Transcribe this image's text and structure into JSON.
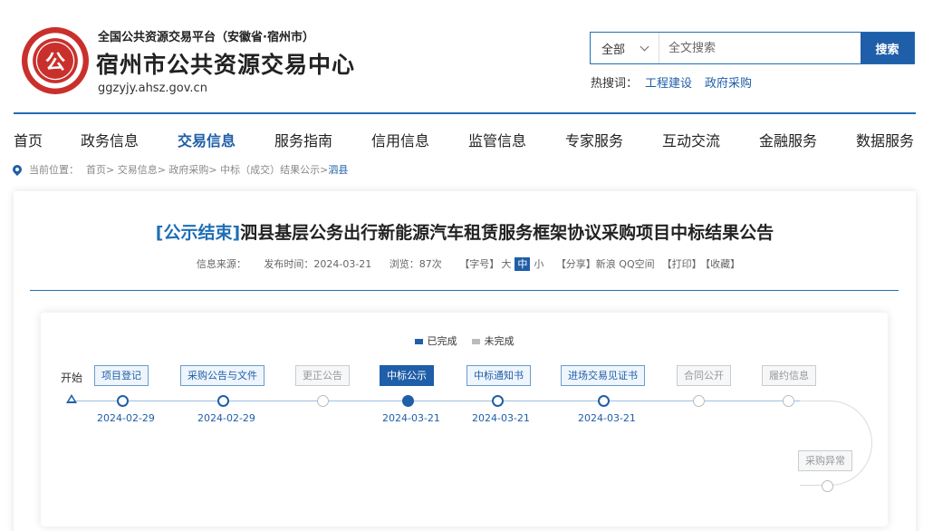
{
  "header": {
    "logo_text": "公",
    "subtitle": "全国公共资源交易平台（安徽省·宿州市）",
    "title": "宿州市公共资源交易中心",
    "url": "ggzyjy.ahsz.gov.cn"
  },
  "search": {
    "scope": "全部",
    "placeholder": "全文搜索",
    "button": "搜索",
    "hot_label": "热搜词：",
    "hot_words": [
      "工程建设",
      "政府采购"
    ]
  },
  "nav": [
    {
      "label": "首页",
      "active": false
    },
    {
      "label": "政务信息",
      "active": false
    },
    {
      "label": "交易信息",
      "active": true
    },
    {
      "label": "服务指南",
      "active": false
    },
    {
      "label": "信用信息",
      "active": false
    },
    {
      "label": "监管信息",
      "active": false
    },
    {
      "label": "专家服务",
      "active": false
    },
    {
      "label": "互动交流",
      "active": false
    },
    {
      "label": "金融服务",
      "active": false
    },
    {
      "label": "数据服务",
      "active": false
    }
  ],
  "breadcrumb": {
    "prefix": "当前位置：",
    "path": "首页> 交易信息> 政府采购> 中标（成交）结果公示>",
    "current": "泗县"
  },
  "article": {
    "tag": "[公示结束]",
    "title": "泗县基层公务出行新能源汽车租赁服务框架协议采购项目中标结果公告",
    "source_label": "信息来源：",
    "publish": "发布时间：2024-03-21",
    "views": "浏览：87次",
    "font_label": "【字号】",
    "font_large": "大",
    "font_medium": "中",
    "font_small": "小",
    "share": "【分享】新浪 QQ空间",
    "print": "【打印】",
    "favorite": "【收藏】"
  },
  "flow": {
    "legend_done": "已完成",
    "legend_todo": "未完成",
    "start": "开始",
    "steps": [
      {
        "label": "项目登记",
        "status": "done",
        "date": "2024-02-29"
      },
      {
        "label": "采购公告与文件",
        "status": "done",
        "date": "2024-02-29"
      },
      {
        "label": "更正公告",
        "status": "todo",
        "date": ""
      },
      {
        "label": "中标公示",
        "status": "current",
        "date": "2024-03-21"
      },
      {
        "label": "中标通知书",
        "status": "done",
        "date": "2024-03-21"
      },
      {
        "label": "进场交易见证书",
        "status": "done",
        "date": "2024-03-21"
      },
      {
        "label": "合同公开",
        "status": "todo",
        "date": ""
      },
      {
        "label": "履约信息",
        "status": "todo",
        "date": ""
      },
      {
        "label": "采购异常",
        "status": "todo",
        "date": ""
      }
    ]
  },
  "colors": {
    "primary": "#1f5ea8",
    "todo": "#bbbbbb",
    "legend_done": "#1f5ea8",
    "legend_todo": "#bbbbbb"
  }
}
